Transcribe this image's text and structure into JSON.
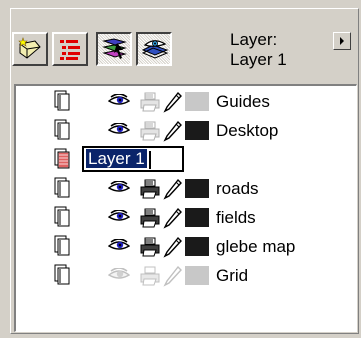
{
  "toolbar": {
    "buttons": [
      {
        "name": "new-layer-button",
        "icon": "new-layer-wand-icon"
      },
      {
        "name": "layer-list-button",
        "icon": "layer-list-icon"
      },
      {
        "name": "layer-filter-button",
        "icon": "layer-filter-icon",
        "pressed": true
      },
      {
        "name": "layer-view-button",
        "icon": "layer-eye-view-icon",
        "pressed": true
      }
    ],
    "layer_title": "Layer:",
    "layer_name": "Layer 1",
    "menu_icon": "flyout-arrow-icon"
  },
  "layers": [
    {
      "label": "Guides",
      "visible": true,
      "printable": false,
      "editable": true,
      "color": "#c8c8c8",
      "dimmed": false
    },
    {
      "label": "Desktop",
      "visible": true,
      "printable": false,
      "editable": true,
      "color": "#1a1a1a",
      "dimmed": false
    },
    {
      "label": "Layer 1",
      "editing": true,
      "page_color": "#e06060"
    },
    {
      "label": "roads",
      "visible": true,
      "printable": true,
      "editable": true,
      "color": "#1a1a1a",
      "dimmed": false
    },
    {
      "label": "fields",
      "visible": true,
      "printable": true,
      "editable": true,
      "color": "#1a1a1a",
      "dimmed": false
    },
    {
      "label": "glebe map",
      "visible": true,
      "printable": true,
      "editable": true,
      "color": "#1a1a1a",
      "dimmed": false
    },
    {
      "label": "Grid",
      "visible": false,
      "printable": false,
      "editable": false,
      "color": "#c8c8c8",
      "dimmed": true
    }
  ],
  "colors": {
    "panel_bg": "#d4d0c8",
    "selection_bg": "#0a246a",
    "selection_fg": "#ffffff"
  }
}
